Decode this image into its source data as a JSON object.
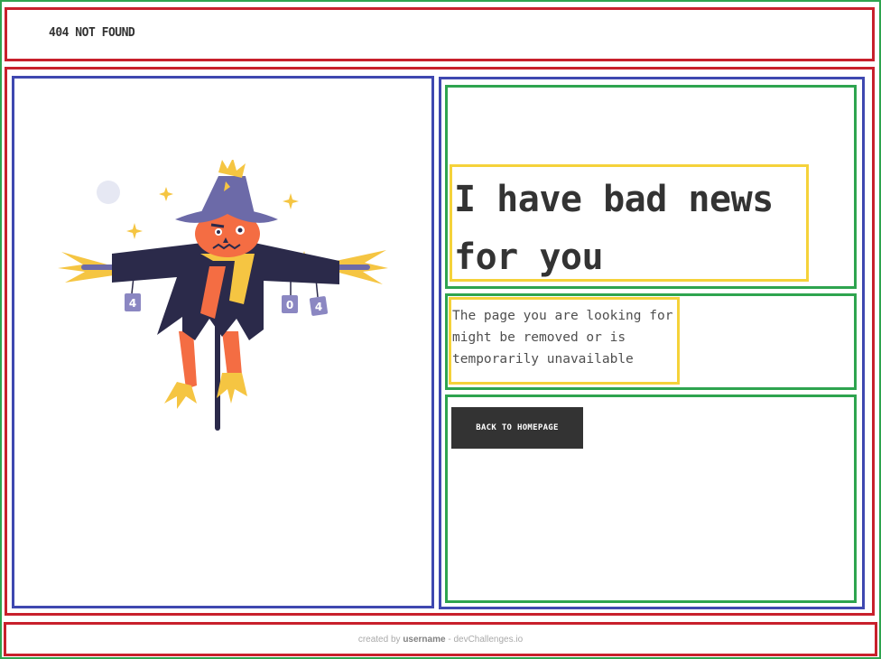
{
  "header": {
    "brand": "404 NOT FOUND"
  },
  "hero": {
    "title": "I have bad news for you",
    "description": "The page you are looking for might be removed or is temporarily unavailable",
    "button_label": "BACK TO HOMEPAGE"
  },
  "illustration": {
    "subject": "scarecrow-illustration",
    "can_labels": [
      "4",
      "0",
      "4"
    ]
  },
  "footer": {
    "prefix": "created by",
    "username": "username",
    "suffix": "- devChallenges.io"
  },
  "colors": {
    "text": "#333333",
    "button_bg": "#333333",
    "button_text": "#ffffff",
    "frame_red": "#c8202c",
    "frame_blue": "#3f48b0",
    "frame_green": "#2ea44f",
    "frame_yellow": "#f5d23a"
  }
}
